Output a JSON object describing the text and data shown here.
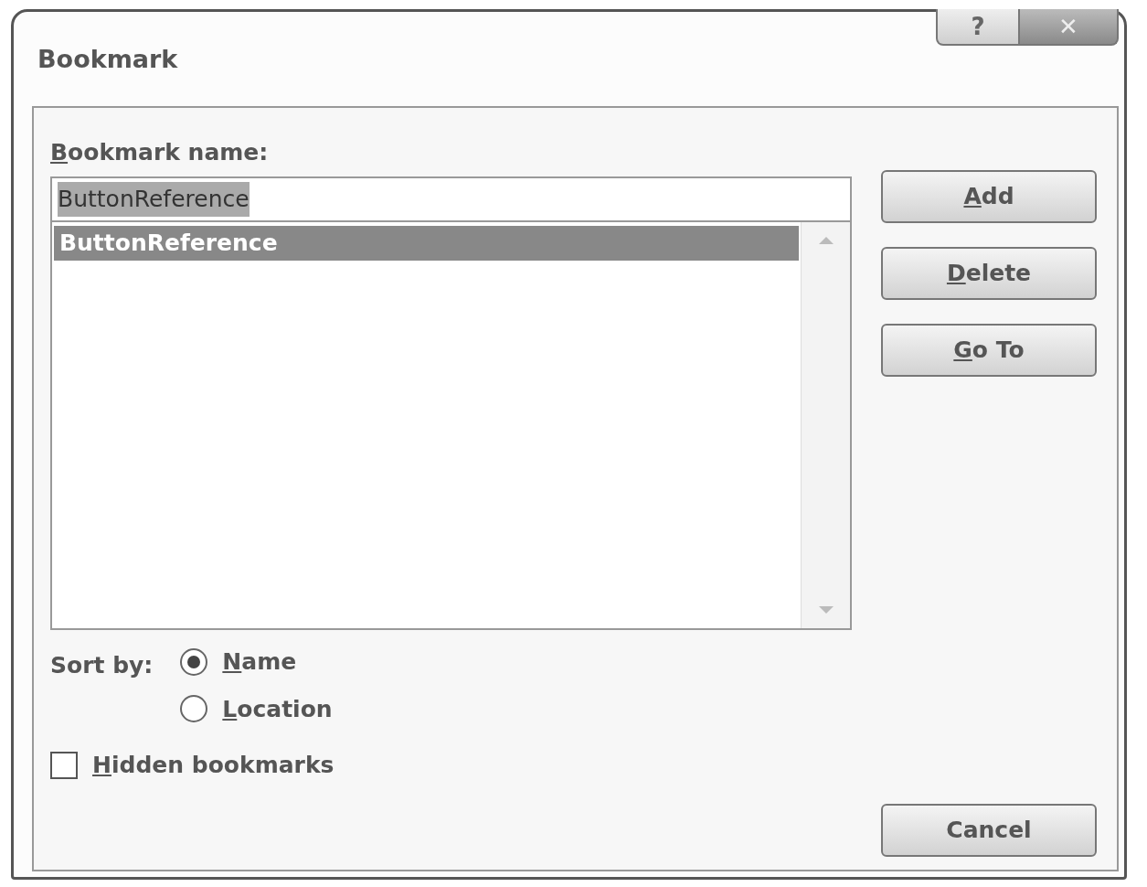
{
  "window": {
    "title": "Bookmark",
    "help_button": "?",
    "close_button": "✕"
  },
  "name_field": {
    "label": "Bookmark name:",
    "underlined_key": true,
    "value": "ButtonReference",
    "value_selected": true
  },
  "bookmarks": [
    {
      "label": "ButtonReference",
      "selected": true
    }
  ],
  "buttons": [
    {
      "label": "Add",
      "underlined_key": true
    },
    {
      "label": "Delete",
      "underlined_key": true
    },
    {
      "label": "Go To",
      "underlined_key": true
    }
  ],
  "sort": {
    "label": "Sort by:",
    "options": [
      {
        "label": "Name",
        "underlined_key": true,
        "selected": true
      },
      {
        "label": "Location",
        "underlined_key": true,
        "selected": false
      }
    ]
  },
  "hidden_bookmarks": {
    "label": "Hidden bookmarks",
    "underlined_key": true,
    "checked": false
  },
  "cancel_button": {
    "label": "Cancel",
    "underlined_key": false
  }
}
